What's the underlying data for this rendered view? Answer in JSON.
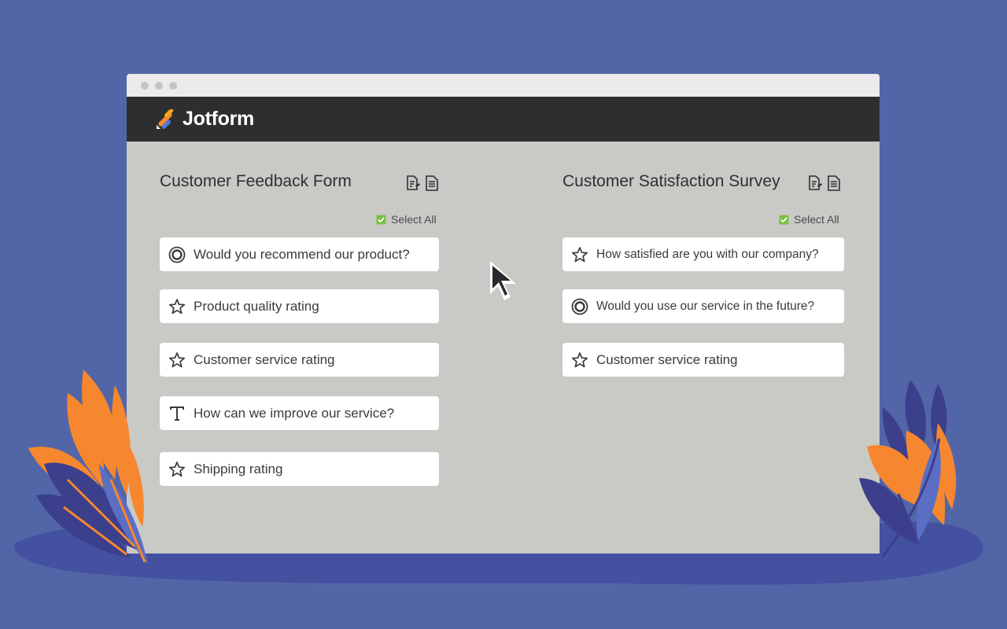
{
  "brand": {
    "name": "Jotform"
  },
  "forms": [
    {
      "title": "Customer Feedback Form",
      "select_all": "Select All",
      "questions": [
        {
          "icon": "radio-icon",
          "label": "Would you recommend our product?"
        },
        {
          "icon": "star-icon",
          "label": "Product quality rating"
        },
        {
          "icon": "star-icon",
          "label": "Customer service rating"
        },
        {
          "icon": "text-icon",
          "label": "How can we improve our service?"
        },
        {
          "icon": "star-icon",
          "label": "Shipping rating"
        }
      ]
    },
    {
      "title": "Customer Satisfaction Survey",
      "select_all": "Select All",
      "questions": [
        {
          "icon": "star-icon",
          "label": "How satisfied are you with our company?"
        },
        {
          "icon": "radio-icon",
          "label": "Would you use our service in the future?"
        },
        {
          "icon": "star-icon",
          "label": "Customer service rating"
        }
      ]
    }
  ],
  "colors": {
    "background": "#5266a7",
    "window": "#c9c9c6",
    "appbar": "#2e2e2e",
    "accent_orange": "#f6872f",
    "accent_navy": "#3b3f8c",
    "check_green": "#7ac143"
  }
}
